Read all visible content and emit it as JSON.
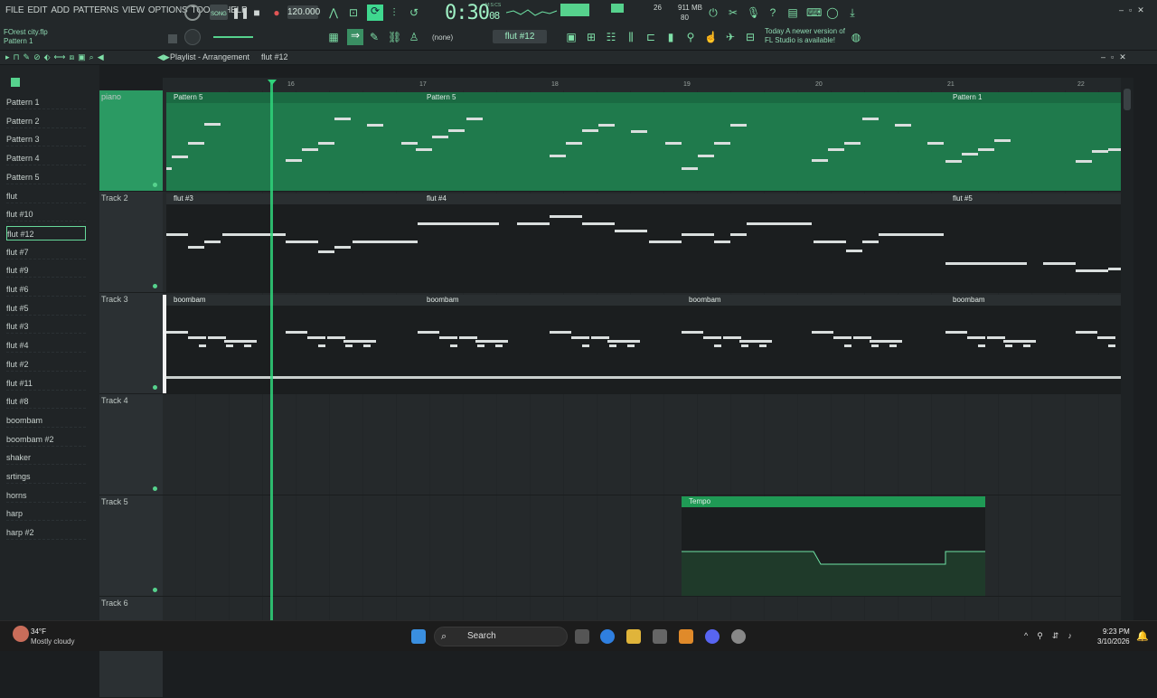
{
  "menu": [
    "FILE",
    "EDIT",
    "ADD",
    "PATTERNS",
    "VIEW",
    "OPTIONS",
    "TOOLS",
    "HELP"
  ],
  "project": {
    "file": "FOrest city.flp",
    "pattern": "Pattern 1"
  },
  "transport": {
    "mode": "SONG",
    "tempo": "120.000",
    "time": "0:30",
    "time_small": "08",
    "time_label": "M:S:CS",
    "cpu": "26",
    "ram": "911 MB",
    "poly": "80"
  },
  "pattern_selector": {
    "current": "flut #12",
    "channel": "(none)"
  },
  "hint": {
    "today": "Today",
    "msg": "A newer version of FL Studio is available!"
  },
  "playlist": {
    "title": "Playlist - Arrangement",
    "pattern": "flut #12"
  },
  "browser": [
    "Pattern 1",
    "Pattern 2",
    "Pattern 3",
    "Pattern 4",
    "Pattern 5",
    "flut",
    "flut #10",
    "flut #12",
    "flut #7",
    "flut #9",
    "flut #6",
    "flut #5",
    "flut #3",
    "flut #4",
    "flut #2",
    "flut #11",
    "flut #8",
    "boombam",
    "boombam #2",
    "shaker",
    "srtings",
    "horns",
    "harp",
    "harp #2"
  ],
  "tracks": [
    "piano",
    "Track 2",
    "Track 3",
    "Track 4",
    "Track 5",
    "Track 6"
  ],
  "ruler": [
    "16",
    "17",
    "18",
    "19",
    "20",
    "21",
    "22"
  ],
  "clips": {
    "t1": [
      "Pattern 5",
      "Pattern 5",
      "Pattern 1"
    ],
    "t2": [
      "flut #3",
      "flut #4",
      "flut #5"
    ],
    "t3": [
      "boombam",
      "boombam",
      "boombam",
      "boombam"
    ],
    "t5": [
      "Tempo"
    ]
  },
  "taskbar": {
    "weather_temp": "34°F",
    "weather_desc": "Mostly cloudy",
    "search": "Search",
    "time": "9:23 PM",
    "date": "3/10/2026"
  },
  "colors": {
    "accent": "#1e8a55",
    "clip_green": "#1f7a4c",
    "playhead": "#2fd37a"
  }
}
